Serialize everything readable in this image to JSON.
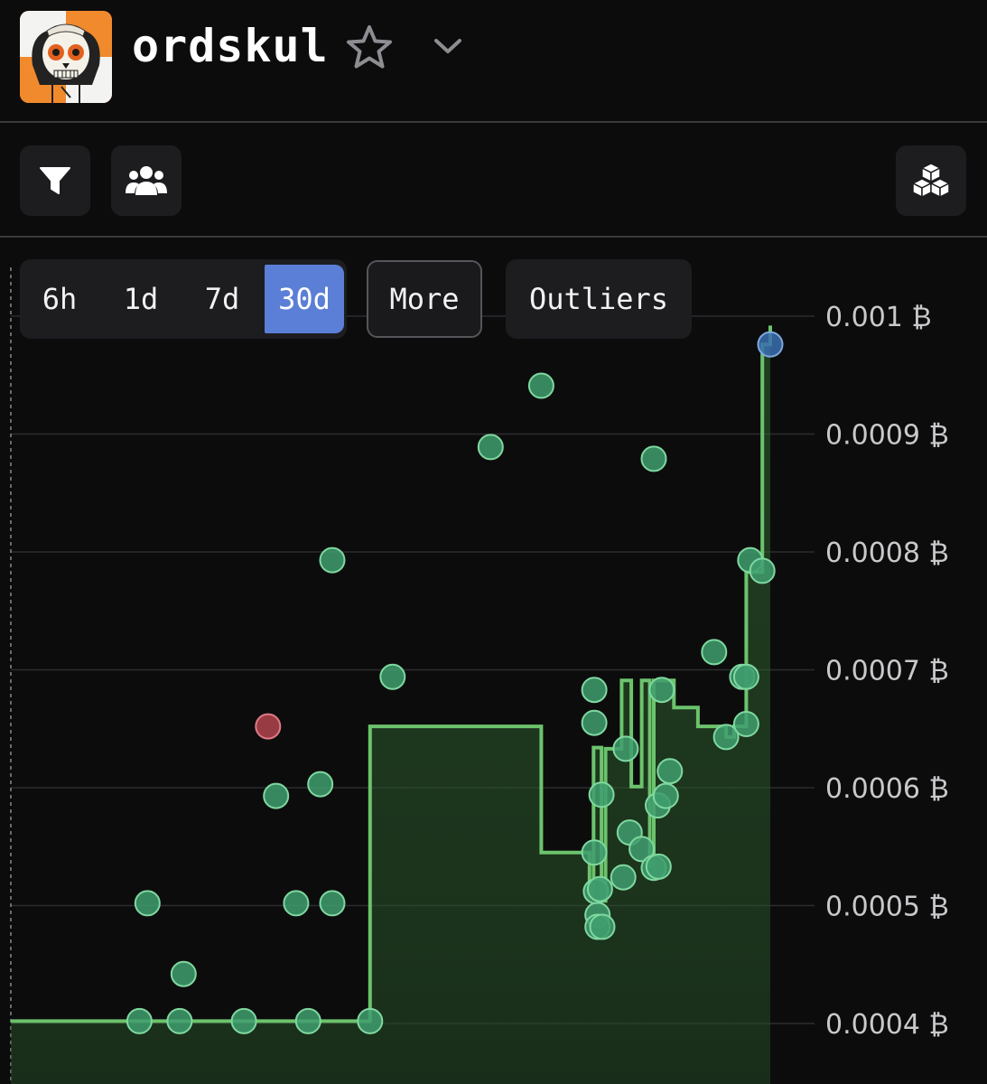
{
  "header": {
    "collection_name": "ordskul",
    "avatar_icon": "skull-avatar-icon",
    "favorite_icon": "star-outline-icon",
    "menu_icon": "chevron-down-icon"
  },
  "toolbar": {
    "filter_icon": "filter-icon",
    "holders_icon": "users-icon",
    "blocks_icon": "cubes-icon"
  },
  "time_ranges": [
    {
      "label": "6h",
      "active": false
    },
    {
      "label": "1d",
      "active": false
    },
    {
      "label": "7d",
      "active": false
    },
    {
      "label": "30d",
      "active": true
    }
  ],
  "more_label": "More",
  "outliers_label": "Outliers",
  "colors": {
    "accent_active": "#5b7fd6",
    "floor_line": "#6cc36c",
    "sale_point": "#3f9e6f",
    "outlier_point": "#b3444e",
    "listing_point": "#3b6fb0"
  },
  "chart_data": {
    "type": "scatter",
    "title": "",
    "xlabel": "",
    "ylabel": "",
    "y_unit": "₿",
    "y_ticks": [
      "0.001 ₿",
      "0.0009 ₿",
      "0.0008 ₿",
      "0.0007 ₿",
      "0.0006 ₿",
      "0.0005 ₿",
      "0.0004 ₿"
    ],
    "ylim": [
      0.0003,
      0.001
    ],
    "xlim": [
      0,
      1
    ],
    "grid": true,
    "legend": "none",
    "series": [
      {
        "kind": "sales",
        "points": [
          [
            0.16,
            0.000402
          ],
          [
            0.17,
            0.000502
          ],
          [
            0.21,
            0.000402
          ],
          [
            0.215,
            0.000442
          ],
          [
            0.29,
            0.000402
          ],
          [
            0.33,
            0.000593
          ],
          [
            0.355,
            0.000502
          ],
          [
            0.37,
            0.000402
          ],
          [
            0.385,
            0.000603
          ],
          [
            0.4,
            0.000793
          ],
          [
            0.4,
            0.000502
          ],
          [
            0.447,
            0.000402
          ],
          [
            0.475,
            0.000694
          ],
          [
            0.597,
            0.000889
          ],
          [
            0.66,
            0.000941
          ],
          [
            0.726,
            0.000683
          ],
          [
            0.726,
            0.000655
          ],
          [
            0.726,
            0.000545
          ],
          [
            0.728,
            0.000512
          ],
          [
            0.73,
            0.000492
          ],
          [
            0.73,
            0.000482
          ],
          [
            0.733,
            0.000514
          ],
          [
            0.735,
            0.000594
          ],
          [
            0.736,
            0.000482
          ],
          [
            0.762,
            0.000524
          ],
          [
            0.765,
            0.000633
          ],
          [
            0.77,
            0.000562
          ],
          [
            0.785,
            0.000548
          ],
          [
            0.8,
            0.000532
          ],
          [
            0.805,
            0.000585
          ],
          [
            0.806,
            0.000533
          ],
          [
            0.81,
            0.000683
          ],
          [
            0.815,
            0.000593
          ],
          [
            0.82,
            0.000614
          ],
          [
            0.8,
            0.000879
          ],
          [
            0.875,
            0.000715
          ],
          [
            0.89,
            0.000643
          ],
          [
            0.91,
            0.000694
          ],
          [
            0.915,
            0.000694
          ],
          [
            0.915,
            0.000654
          ],
          [
            0.92,
            0.000793
          ],
          [
            0.935,
            0.000784
          ]
        ]
      },
      {
        "kind": "outlier",
        "points": [
          [
            0.32,
            0.000652
          ]
        ]
      },
      {
        "kind": "listing",
        "points": [
          [
            0.945,
            0.000976
          ]
        ]
      },
      {
        "kind": "floor",
        "type": "step",
        "points": [
          [
            0.0,
            0.000402
          ],
          [
            0.447,
            0.000402
          ],
          [
            0.447,
            0.000652
          ],
          [
            0.66,
            0.000652
          ],
          [
            0.66,
            0.000545
          ],
          [
            0.72,
            0.000545
          ],
          [
            0.72,
            0.000512
          ],
          [
            0.725,
            0.000512
          ],
          [
            0.725,
            0.000634
          ],
          [
            0.735,
            0.000634
          ],
          [
            0.735,
            0.000504
          ],
          [
            0.74,
            0.000504
          ],
          [
            0.74,
            0.000633
          ],
          [
            0.76,
            0.000633
          ],
          [
            0.76,
            0.000691
          ],
          [
            0.772,
            0.000691
          ],
          [
            0.772,
            0.000601
          ],
          [
            0.785,
            0.000601
          ],
          [
            0.785,
            0.000691
          ],
          [
            0.795,
            0.000691
          ],
          [
            0.795,
            0.000533
          ],
          [
            0.8,
            0.000533
          ],
          [
            0.8,
            0.000691
          ],
          [
            0.825,
            0.000691
          ],
          [
            0.825,
            0.000668
          ],
          [
            0.855,
            0.000668
          ],
          [
            0.855,
            0.000652
          ],
          [
            0.89,
            0.000652
          ],
          [
            0.89,
            0.000643
          ],
          [
            0.9,
            0.000643
          ],
          [
            0.9,
            0.000652
          ],
          [
            0.915,
            0.000652
          ],
          [
            0.915,
            0.000783
          ],
          [
            0.935,
            0.000783
          ],
          [
            0.935,
            0.000976
          ],
          [
            0.945,
            0.000976
          ],
          [
            0.945,
            0.000992
          ]
        ]
      }
    ]
  }
}
